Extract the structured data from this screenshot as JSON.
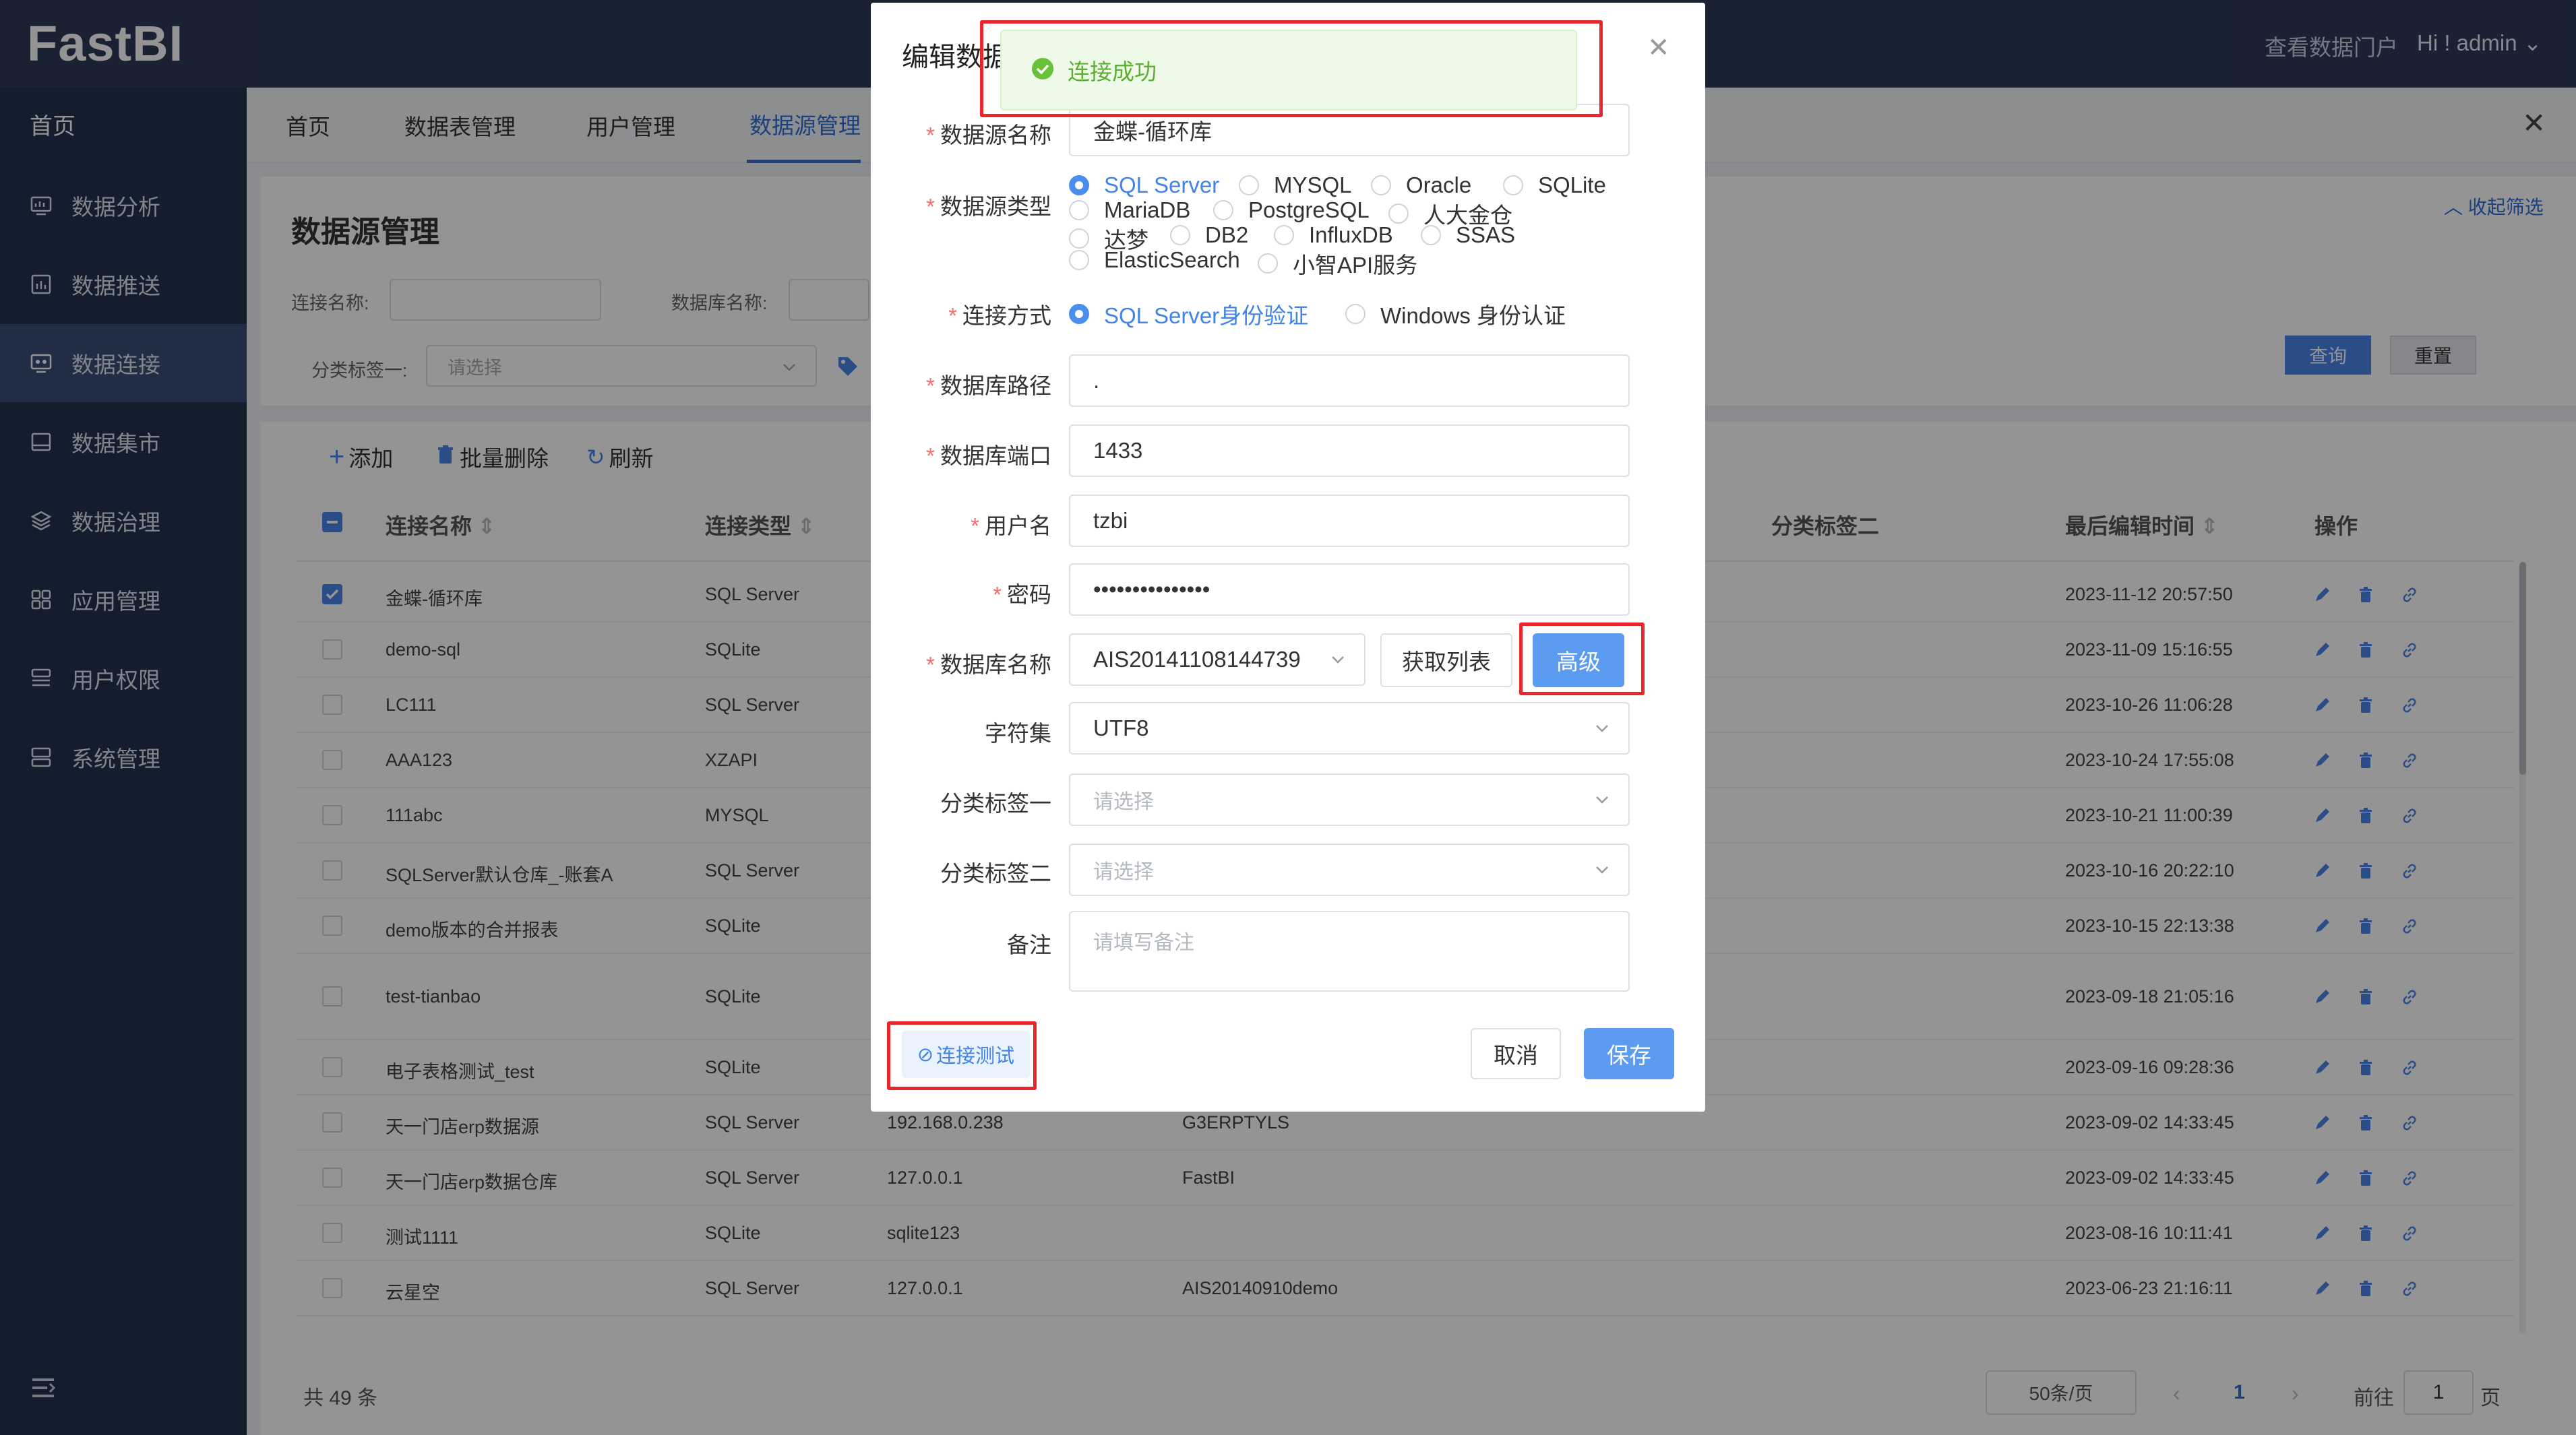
{
  "app": {
    "logo": "FastBI",
    "portal_link": "查看数据门户",
    "user_greeting": "Hi ! admin"
  },
  "sidebar": {
    "home": "首页",
    "items": [
      {
        "label": "数据分析",
        "icon": "chart-monitor-icon"
      },
      {
        "label": "数据推送",
        "icon": "bar-chart-icon"
      },
      {
        "label": "数据连接",
        "icon": "connection-icon",
        "active": true
      },
      {
        "label": "数据集市",
        "icon": "dataset-icon"
      },
      {
        "label": "数据治理",
        "icon": "layers-icon"
      },
      {
        "label": "应用管理",
        "icon": "apps-icon"
      },
      {
        "label": "用户权限",
        "icon": "user-permission-icon"
      },
      {
        "label": "系统管理",
        "icon": "system-icon"
      }
    ]
  },
  "tabs": [
    {
      "label": "首页"
    },
    {
      "label": "数据表管理"
    },
    {
      "label": "用户管理"
    },
    {
      "label": "数据源管理",
      "active": true
    }
  ],
  "filter": {
    "title": "数据源管理",
    "conn_name_label": "连接名称:",
    "db_name_label": "数据库名称:",
    "tag1_label": "分类标签一:",
    "tag1_placeholder": "请选择",
    "collapse_label": "收起筛选",
    "query_label": "查询",
    "reset_label": "重置"
  },
  "toolbar": {
    "add": "添加",
    "batch_delete": "批量删除",
    "refresh": "刷新"
  },
  "table": {
    "headers": {
      "name": "连接名称",
      "type": "连接类型",
      "tag2": "分类标签二",
      "edit_time": "最后编辑时间",
      "ops": "操作"
    },
    "rows": [
      {
        "name": "金蝶-循环库",
        "type": "SQL Server",
        "host": "",
        "db": "",
        "time": "2023-11-12 20:57:50",
        "checked": true
      },
      {
        "name": "demo-sql",
        "type": "SQLite",
        "host": "",
        "db": "",
        "time": "2023-11-09 15:16:55"
      },
      {
        "name": "LC111",
        "type": "SQL Server",
        "host": "",
        "db": "",
        "time": "2023-10-26 11:06:28"
      },
      {
        "name": "AAA123",
        "type": "XZAPI",
        "host": "",
        "db": "",
        "time": "2023-10-24 17:55:08"
      },
      {
        "name": "111abc",
        "type": "MYSQL",
        "host": "",
        "db": "",
        "time": "2023-10-21 11:00:39"
      },
      {
        "name": "SQLServer默认仓库_-账套A",
        "type": "SQL Server",
        "host": "",
        "db": "",
        "time": "2023-10-16 20:22:10"
      },
      {
        "name": "demo版本的合并报表",
        "type": "SQLite",
        "host": "",
        "db": "",
        "time": "2023-10-15 22:13:38"
      },
      {
        "name": "test-tianbao",
        "type": "SQLite",
        "host": "",
        "db": "",
        "time": "2023-09-18 21:05:16"
      },
      {
        "name": "电子表格测试_test",
        "type": "SQLite",
        "host": "",
        "db": "",
        "time": "2023-09-16 09:28:36"
      },
      {
        "name": "天一门店erp数据源",
        "type": "SQL Server",
        "host": "192.168.0.238",
        "db": "G3ERPTYLS",
        "time": "2023-09-02 14:33:45"
      },
      {
        "name": "天一门店erp数据仓库",
        "type": "SQL Server",
        "host": "127.0.0.1",
        "db": "FastBI",
        "time": "2023-09-02 14:33:45"
      },
      {
        "name": "测试1111",
        "type": "SQLite",
        "host": "sqlite123",
        "db": "",
        "time": "2023-08-16 10:11:41"
      },
      {
        "name": "云星空",
        "type": "SQL Server",
        "host": "127.0.0.1",
        "db": "AIS20140910demo",
        "time": "2023-06-23 21:16:11"
      }
    ]
  },
  "pagination": {
    "total": "共 49 条",
    "page_size": "50条/页",
    "prev": "‹",
    "current": "1",
    "next": "›",
    "goto_label": "前往",
    "goto_value": "1",
    "goto_unit": "页"
  },
  "dialog": {
    "title": "编辑数据",
    "toast": "连接成功",
    "name_label": "数据源名称",
    "name_value": "金蝶-循环库",
    "type_label": "数据源类型",
    "types": [
      [
        {
          "label": "SQL Server",
          "checked": true
        },
        {
          "label": "MYSQL"
        },
        {
          "label": "Oracle"
        },
        {
          "label": "SQLite"
        }
      ],
      [
        {
          "label": "MariaDB"
        },
        {
          "label": "PostgreSQL"
        },
        {
          "label": "人大金仓"
        }
      ],
      [
        {
          "label": "达梦"
        },
        {
          "label": "DB2"
        },
        {
          "label": "InfluxDB"
        },
        {
          "label": "SSAS"
        }
      ],
      [
        {
          "label": "ElasticSearch"
        },
        {
          "label": "小智API服务"
        }
      ]
    ],
    "auth_label": "连接方式",
    "auth_options": [
      {
        "label": "SQL Server身份验证",
        "checked": true
      },
      {
        "label": "Windows 身份认证"
      }
    ],
    "path_label": "数据库路径",
    "path_value": ".",
    "port_label": "数据库端口",
    "port_value": "1433",
    "user_label": "用户名",
    "user_value": "tzbi",
    "pwd_label": "密码",
    "pwd_value": "•••••••••••••••",
    "dbname_label": "数据库名称",
    "dbname_value": "AIS20141108144739",
    "getlist_label": "获取列表",
    "advanced_label": "高级",
    "charset_label": "字符集",
    "charset_value": "UTF8",
    "tag1_label": "分类标签一",
    "tag1_placeholder": "请选择",
    "tag2_label": "分类标签二",
    "tag2_placeholder": "请选择",
    "remark_label": "备注",
    "remark_placeholder": "请填写备注",
    "test_label": "连接测试",
    "cancel_label": "取消",
    "save_label": "保存"
  },
  "colors": {
    "primary": "#4a86e8",
    "sidebar": "#243350",
    "header": "#2b3a57",
    "highlight": "#e8262b",
    "success": "#5daf34"
  }
}
